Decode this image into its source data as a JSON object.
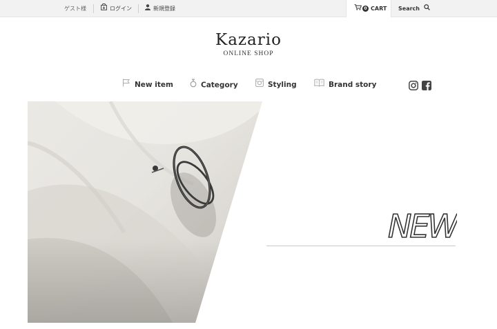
{
  "topbar": {
    "guest_label": "ゲスト様",
    "login_label": "ログイン",
    "register_label": "新規登録",
    "cart_count": "0",
    "cart_label": "CART",
    "search_label": "Search"
  },
  "brand": {
    "logo_text": "Kazario",
    "logo_sub": "ONLINE SHOP"
  },
  "nav": {
    "items": [
      {
        "label": "New item",
        "icon": "flag-icon"
      },
      {
        "label": "Category",
        "icon": "ring-icon"
      },
      {
        "label": "Styling",
        "icon": "styling-icon"
      },
      {
        "label": "Brand story",
        "icon": "book-icon"
      }
    ],
    "social": [
      "instagram-icon",
      "facebook-icon"
    ]
  },
  "hero": {
    "image": "ring-on-white-fabric-photo",
    "headline": "NEW"
  }
}
